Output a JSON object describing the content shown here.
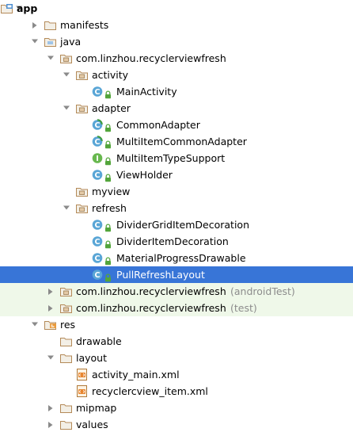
{
  "colors": {
    "selection": "#3875d7",
    "test_row": "#eff8e9",
    "folder": "#b48a58",
    "class_badge": "#5aa6d6",
    "interface_badge": "#68b84f",
    "lock": "#53a53b"
  },
  "tree": [
    {
      "label": "app",
      "icon": "module-folder-icon",
      "expanded": true,
      "bold": true
    },
    {
      "label": "manifests",
      "icon": "folder-icon",
      "expanded": false
    },
    {
      "label": "java",
      "icon": "source-folder-icon",
      "expanded": true
    },
    {
      "label": "com.linzhou.recyclerviewfresh",
      "icon": "package-icon",
      "expanded": true
    },
    {
      "label": "activity",
      "icon": "package-icon",
      "expanded": true
    },
    {
      "label": "MainActivity",
      "icon": "class-icon"
    },
    {
      "label": "adapter",
      "icon": "package-icon",
      "expanded": true
    },
    {
      "label": "CommonAdapter",
      "icon": "abstract-class-icon"
    },
    {
      "label": "MultiItemCommonAdapter",
      "icon": "abstract-class-icon"
    },
    {
      "label": "MultiItemTypeSupport",
      "icon": "interface-icon"
    },
    {
      "label": "ViewHolder",
      "icon": "class-icon"
    },
    {
      "label": "myview",
      "icon": "package-icon"
    },
    {
      "label": "refresh",
      "icon": "package-icon",
      "expanded": true
    },
    {
      "label": "DividerGridItemDecoration",
      "icon": "class-icon"
    },
    {
      "label": "DividerItemDecoration",
      "icon": "class-icon"
    },
    {
      "label": "MaterialProgressDrawable",
      "icon": "class-icon"
    },
    {
      "label": "PullRefreshLayout",
      "icon": "class-icon",
      "selected": true
    },
    {
      "label": "com.linzhou.recyclerviewfresh",
      "suffix": "(androidTest)",
      "icon": "package-icon",
      "expanded": false
    },
    {
      "label": "com.linzhou.recyclerviewfresh",
      "suffix": "(test)",
      "icon": "package-icon",
      "expanded": false
    },
    {
      "label": "res",
      "icon": "resource-folder-icon",
      "expanded": true
    },
    {
      "label": "drawable",
      "icon": "folder-icon"
    },
    {
      "label": "layout",
      "icon": "folder-icon",
      "expanded": true
    },
    {
      "label": "activity_main.xml",
      "icon": "xml-file-icon"
    },
    {
      "label": "recyclercview_item.xml",
      "icon": "xml-file-icon"
    },
    {
      "label": "mipmap",
      "icon": "folder-icon",
      "expanded": false
    },
    {
      "label": "values",
      "icon": "folder-icon",
      "expanded": false
    }
  ]
}
